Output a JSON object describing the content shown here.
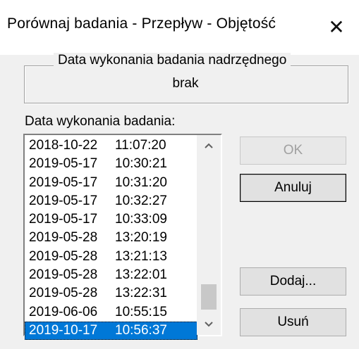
{
  "window": {
    "title": "Porównaj badania - Przepływ - Objętość",
    "close_glyph": "✕"
  },
  "group": {
    "legend": "Data wykonania badania nadrzędnego",
    "value": "brak"
  },
  "list": {
    "label": "Data wykonania badania:",
    "rows": [
      {
        "date": "2018-10-22",
        "time": "11:07:20"
      },
      {
        "date": "2019-05-17",
        "time": "10:30:21"
      },
      {
        "date": "2019-05-17",
        "time": "10:31:20"
      },
      {
        "date": "2019-05-17",
        "time": "10:32:27"
      },
      {
        "date": "2019-05-17",
        "time": "10:33:09"
      },
      {
        "date": "2019-05-28",
        "time": "13:20:19"
      },
      {
        "date": "2019-05-28",
        "time": "13:21:13"
      },
      {
        "date": "2019-05-28",
        "time": "13:22:01"
      },
      {
        "date": "2019-05-28",
        "time": "13:22:31"
      },
      {
        "date": "2019-06-06",
        "time": "10:55:15"
      },
      {
        "date": "2019-10-17",
        "time": "10:56:37"
      }
    ],
    "selected_index": 10
  },
  "buttons": {
    "ok": "OK",
    "cancel": "Anuluj",
    "add": "Dodaj...",
    "remove": "Usuń"
  },
  "colors": {
    "selection": "#0078d7",
    "dialog_bg": "#f0f0f0"
  }
}
